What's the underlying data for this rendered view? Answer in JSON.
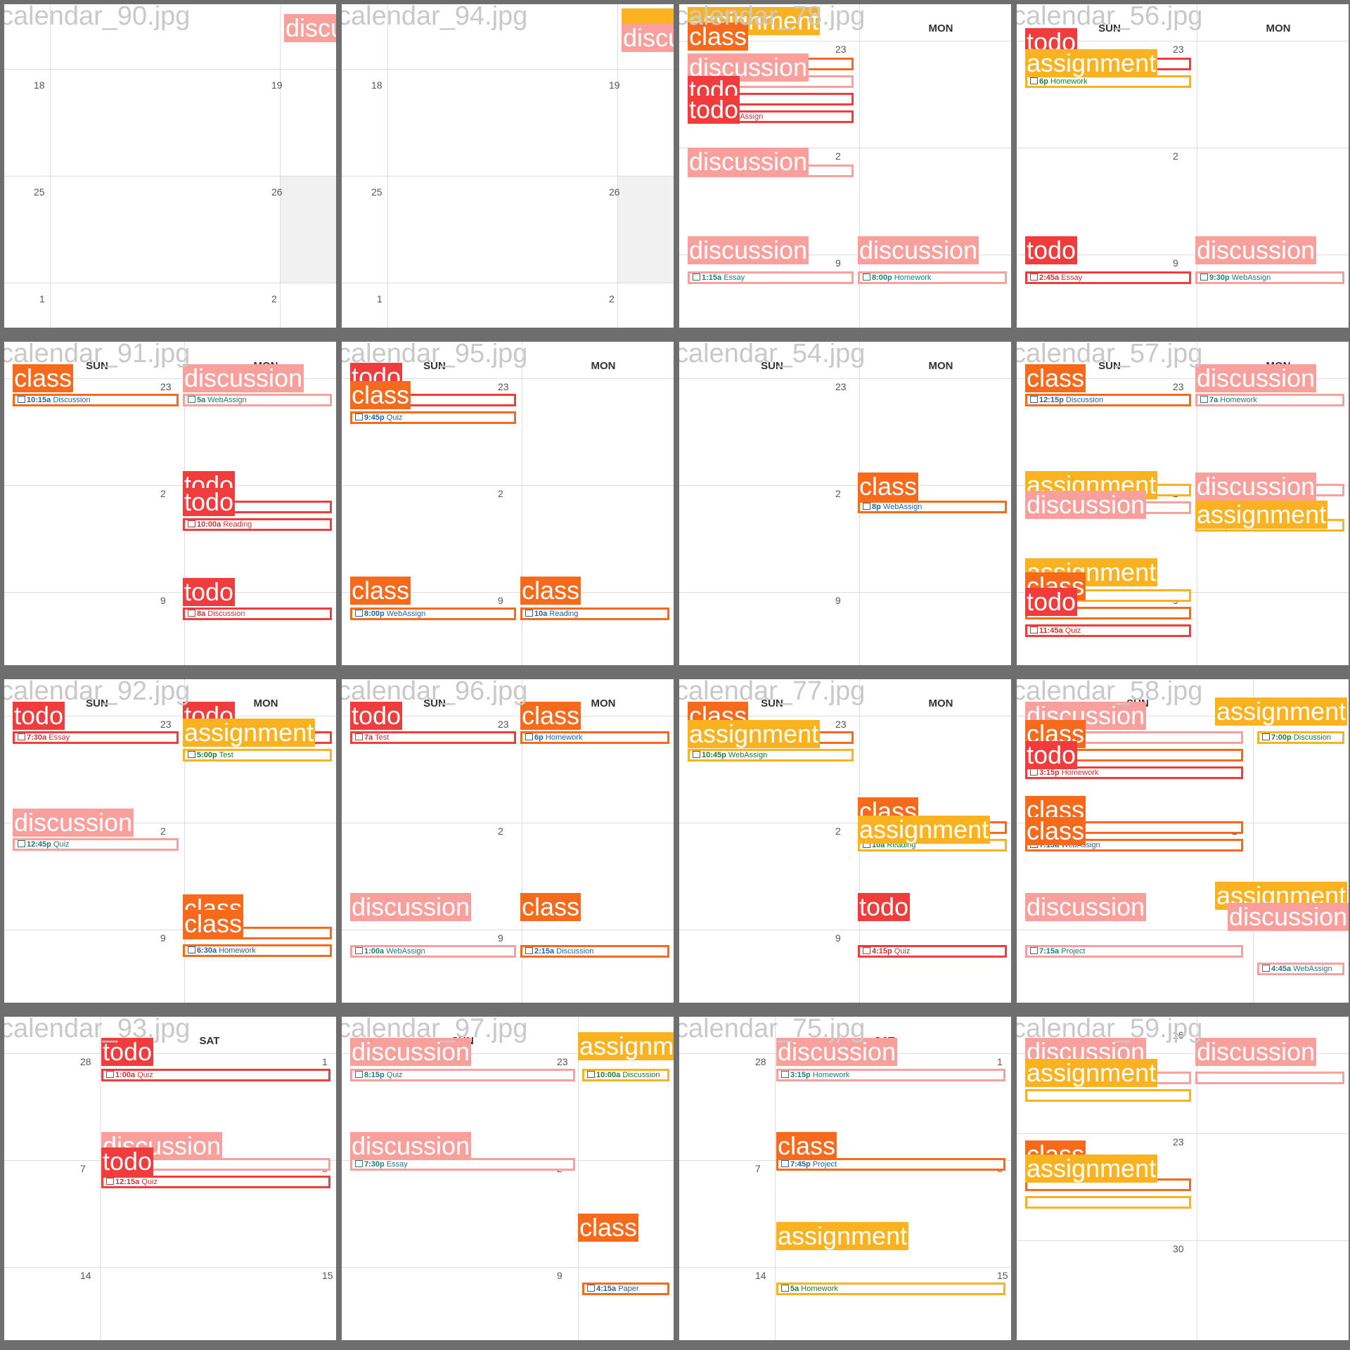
{
  "tiles": [
    {
      "file": "calendar_90.jpg",
      "headers": [],
      "nums": [
        "18",
        "19",
        "25",
        "26",
        "1",
        "2"
      ],
      "events": [],
      "labels": [
        {
          "cls": "discussion",
          "text": "discussion"
        }
      ]
    },
    {
      "file": "calendar_94.jpg",
      "headers": [],
      "nums": [
        "18",
        "19",
        "25",
        "26",
        "1",
        "2"
      ],
      "events": [],
      "labels": [
        {
          "cls": "assignment",
          "text": ""
        },
        {
          "cls": "discussion",
          "text": "discussion"
        }
      ]
    },
    {
      "file": "calendar_78.jpg",
      "headers": [
        "SUN",
        "MON"
      ],
      "nums": [
        "23",
        "2",
        "9"
      ],
      "events": [
        {
          "cls": "class",
          "time": "",
          "title": ""
        },
        {
          "cls": "discussion",
          "time": "",
          "title": "er"
        },
        {
          "cls": "todo",
          "time": "",
          "title": "bAssign"
        },
        {
          "cls": "todo",
          "time": "1:45p",
          "title": "WebAssign"
        },
        {
          "cls": "discussion",
          "time": "1:30a",
          "title": "Test"
        },
        {
          "cls": "discussion",
          "time": "1:15a",
          "title": "Essay"
        },
        {
          "cls": "discussion",
          "time": "8:00p",
          "title": "Homework"
        }
      ],
      "labels": [
        {
          "cls": "assignment",
          "text": "assignment"
        },
        {
          "cls": "class",
          "text": "class"
        },
        {
          "cls": "discussion",
          "text": "discussion"
        },
        {
          "cls": "todo",
          "text": "todo"
        },
        {
          "cls": "todo",
          "text": "todo"
        },
        {
          "cls": "discussion",
          "text": "discussion"
        },
        {
          "cls": "discussion",
          "text": "discussion"
        },
        {
          "cls": "discussion",
          "text": "discussion"
        }
      ]
    },
    {
      "file": "calendar_56.jpg",
      "headers": [
        "SUN",
        "MON"
      ],
      "nums": [
        "23",
        "2",
        "9"
      ],
      "events": [
        {
          "cls": "todo",
          "time": "",
          "title": ""
        },
        {
          "cls": "assignment",
          "time": "6p",
          "title": "Homework"
        },
        {
          "cls": "todo",
          "time": "2:45a",
          "title": "Essay"
        },
        {
          "cls": "discussion",
          "time": "9:30p",
          "title": "WebAssign"
        }
      ],
      "labels": [
        {
          "cls": "todo",
          "text": "todo"
        },
        {
          "cls": "assignment",
          "text": "assignment"
        },
        {
          "cls": "todo",
          "text": "todo"
        },
        {
          "cls": "discussion",
          "text": "discussion"
        }
      ]
    },
    {
      "file": "calendar_91.jpg",
      "headers": [
        "SUN",
        "MON"
      ],
      "nums": [
        "23",
        "2",
        "9"
      ],
      "events": [
        {
          "cls": "class",
          "time": "10:15a",
          "title": "Discussion"
        },
        {
          "cls": "discussion",
          "time": "5a",
          "title": "WebAssign"
        },
        {
          "cls": "todo",
          "time": "",
          "title": "nework"
        },
        {
          "cls": "todo",
          "time": "10:00a",
          "title": "Reading"
        },
        {
          "cls": "todo",
          "time": "8a",
          "title": "Discussion"
        }
      ],
      "labels": [
        {
          "cls": "class",
          "text": "class"
        },
        {
          "cls": "discussion",
          "text": "discussion"
        },
        {
          "cls": "todo",
          "text": "todo"
        },
        {
          "cls": "todo",
          "text": "todo"
        },
        {
          "cls": "todo",
          "text": "todo"
        }
      ]
    },
    {
      "file": "calendar_95.jpg",
      "headers": [
        "SUN",
        "MON"
      ],
      "nums": [
        "23",
        "2",
        "9"
      ],
      "events": [
        {
          "cls": "todo",
          "time": "",
          "title": "ssign"
        },
        {
          "cls": "class",
          "time": "9:45p",
          "title": "Quiz"
        },
        {
          "cls": "class",
          "time": "8:00p",
          "title": "WebAssign"
        },
        {
          "cls": "class",
          "time": "10a",
          "title": "Reading"
        }
      ],
      "labels": [
        {
          "cls": "todo",
          "text": "todo"
        },
        {
          "cls": "class",
          "text": "class"
        },
        {
          "cls": "class",
          "text": "class"
        },
        {
          "cls": "class",
          "text": "class"
        }
      ]
    },
    {
      "file": "calendar_54.jpg",
      "headers": [
        "SUN",
        "MON"
      ],
      "nums": [
        "23",
        "2",
        "9"
      ],
      "events": [
        {
          "cls": "class",
          "time": "8p",
          "title": "WebAssign"
        }
      ],
      "labels": [
        {
          "cls": "class",
          "text": "class"
        }
      ]
    },
    {
      "file": "calendar_57.jpg",
      "headers": [
        "SUN",
        "MON"
      ],
      "nums": [
        "23",
        "2",
        "9"
      ],
      "events": [
        {
          "cls": "class",
          "time": "12:15p",
          "title": "Discussion"
        },
        {
          "cls": "discussion",
          "time": "7a",
          "title": "Homework"
        },
        {
          "cls": "assignment",
          "time": "",
          "title": ""
        },
        {
          "cls": "discussion",
          "time": "5:15a",
          "title": "Essay"
        },
        {
          "cls": "discussion",
          "time": "",
          "title": ""
        },
        {
          "cls": "assignment",
          "time": "4:15p",
          "title": "Test"
        },
        {
          "cls": "assignment",
          "time": "",
          "title": ""
        },
        {
          "cls": "class",
          "time": "",
          "title": "mework"
        },
        {
          "cls": "todo",
          "time": "11:45a",
          "title": "Quiz"
        }
      ],
      "labels": [
        {
          "cls": "class",
          "text": "class"
        },
        {
          "cls": "discussion",
          "text": "discussion"
        },
        {
          "cls": "assignment",
          "text": "assignment"
        },
        {
          "cls": "discussion",
          "text": "discussion"
        },
        {
          "cls": "discussion",
          "text": "discussion"
        },
        {
          "cls": "assignment",
          "text": "assignment"
        },
        {
          "cls": "assignment",
          "text": "assignment"
        },
        {
          "cls": "class",
          "text": "class"
        },
        {
          "cls": "todo",
          "text": "todo"
        }
      ]
    },
    {
      "file": "calendar_92.jpg",
      "headers": [
        "SUN",
        "MON"
      ],
      "nums": [
        "23",
        "2",
        "9"
      ],
      "events": [
        {
          "cls": "todo",
          "time": "7:30a",
          "title": "Essay"
        },
        {
          "cls": "todo",
          "time": "",
          "title": ""
        },
        {
          "cls": "assignment",
          "time": "5:00p",
          "title": "Test"
        },
        {
          "cls": "discussion",
          "time": "12:45p",
          "title": "Quiz"
        },
        {
          "cls": "class",
          "time": "",
          "title": ""
        },
        {
          "cls": "class",
          "time": "6:30a",
          "title": "Homework"
        }
      ],
      "labels": [
        {
          "cls": "todo",
          "text": "todo"
        },
        {
          "cls": "todo",
          "text": "todo"
        },
        {
          "cls": "assignment",
          "text": "assignment"
        },
        {
          "cls": "discussion",
          "text": "discussion"
        },
        {
          "cls": "class",
          "text": "class"
        },
        {
          "cls": "class",
          "text": "class"
        }
      ]
    },
    {
      "file": "calendar_96.jpg",
      "headers": [
        "SUN",
        "MON"
      ],
      "nums": [
        "23",
        "2",
        "9"
      ],
      "events": [
        {
          "cls": "todo",
          "time": "7a",
          "title": "Test"
        },
        {
          "cls": "class",
          "time": "6p",
          "title": "Homework"
        },
        {
          "cls": "discussion",
          "time": "1:00a",
          "title": "WebAssign"
        },
        {
          "cls": "class",
          "time": "2:15a",
          "title": "Discussion"
        }
      ],
      "labels": [
        {
          "cls": "todo",
          "text": "todo"
        },
        {
          "cls": "class",
          "text": "class"
        },
        {
          "cls": "discussion",
          "text": "discussion"
        },
        {
          "cls": "class",
          "text": "class"
        }
      ]
    },
    {
      "file": "calendar_77.jpg",
      "headers": [
        "SUN",
        "MON"
      ],
      "nums": [
        "23",
        "2",
        "9"
      ],
      "events": [
        {
          "cls": "class",
          "time": "",
          "title": ""
        },
        {
          "cls": "assignment",
          "time": "10:45p",
          "title": "WebAssign"
        },
        {
          "cls": "class",
          "time": "",
          "title": ""
        },
        {
          "cls": "assignment",
          "time": "10a",
          "title": "Reading"
        },
        {
          "cls": "todo",
          "time": "4:15p",
          "title": "Quiz"
        }
      ],
      "labels": [
        {
          "cls": "class",
          "text": "class"
        },
        {
          "cls": "assignment",
          "text": "assignment"
        },
        {
          "cls": "class",
          "text": "class"
        },
        {
          "cls": "assignment",
          "text": "assignment"
        },
        {
          "cls": "todo",
          "text": "todo"
        }
      ]
    },
    {
      "file": "calendar_58.jpg",
      "headers": [
        "SUN",
        ""
      ],
      "nums": [
        "2"
      ],
      "events": [
        {
          "cls": "discussion",
          "time": "",
          "title": ""
        },
        {
          "cls": "assignment",
          "time": "7:00p",
          "title": "Discussion"
        },
        {
          "cls": "class",
          "time": "",
          "title": "ding"
        },
        {
          "cls": "todo",
          "time": "3:15p",
          "title": "Homework"
        },
        {
          "cls": "class",
          "time": "",
          "title": "t"
        },
        {
          "cls": "class",
          "time": "7:15a",
          "title": "WebAssign"
        },
        {
          "cls": "discussion",
          "time": "7:15a",
          "title": "Project"
        },
        {
          "cls": "discussion",
          "time": "4:45a",
          "title": "WebAssign"
        }
      ],
      "labels": [
        {
          "cls": "discussion",
          "text": "discussion"
        },
        {
          "cls": "assignment",
          "text": "assignment"
        },
        {
          "cls": "class",
          "text": "class"
        },
        {
          "cls": "todo",
          "text": "todo"
        },
        {
          "cls": "class",
          "text": "class"
        },
        {
          "cls": "class",
          "text": "class"
        },
        {
          "cls": "discussion",
          "text": "discussion"
        },
        {
          "cls": "assignment",
          "text": "assignment"
        },
        {
          "cls": "discussion",
          "text": "discussion"
        }
      ]
    },
    {
      "file": "calendar_93.jpg",
      "headers": [
        "SAT"
      ],
      "nums": [
        "28",
        "1",
        "7",
        "8",
        "14",
        "15"
      ],
      "events": [
        {
          "cls": "todo",
          "time": "1:00a",
          "title": "Quiz"
        },
        {
          "cls": "discussion",
          "time": "",
          "title": ""
        },
        {
          "cls": "todo",
          "time": "12:15a",
          "title": "Quiz"
        }
      ],
      "labels": [
        {
          "cls": "todo",
          "text": "todo"
        },
        {
          "cls": "discussion",
          "text": "discussion"
        },
        {
          "cls": "todo",
          "text": "todo"
        }
      ]
    },
    {
      "file": "calendar_97.jpg",
      "headers": [
        "SUN"
      ],
      "nums": [
        "23",
        "2",
        "9"
      ],
      "events": [
        {
          "cls": "discussion",
          "time": "8:15p",
          "title": "Quiz"
        },
        {
          "cls": "assignment",
          "time": "10:00a",
          "title": "Discussion"
        },
        {
          "cls": "discussion",
          "time": "7:30p",
          "title": "Essay"
        },
        {
          "cls": "class",
          "time": "4:15a",
          "title": "Paper"
        }
      ],
      "labels": [
        {
          "cls": "discussion",
          "text": "discussion"
        },
        {
          "cls": "assignment",
          "text": "assignment"
        },
        {
          "cls": "discussion",
          "text": "discussion"
        },
        {
          "cls": "class",
          "text": "class"
        }
      ]
    },
    {
      "file": "calendar_75.jpg",
      "headers": [
        "SAT"
      ],
      "nums": [
        "28",
        "1",
        "7",
        "8",
        "14",
        "15"
      ],
      "events": [
        {
          "cls": "discussion",
          "time": "3:15p",
          "title": "Homework"
        },
        {
          "cls": "class",
          "time": "7:45p",
          "title": "Project"
        },
        {
          "cls": "assignment",
          "time": "5a",
          "title": "Homework"
        }
      ],
      "labels": [
        {
          "cls": "discussion",
          "text": "discussion"
        },
        {
          "cls": "class",
          "text": "class"
        },
        {
          "cls": "assignment",
          "text": "assignment"
        }
      ]
    },
    {
      "file": "calendar_59.jpg",
      "headers": [],
      "nums": [
        "16",
        "23",
        "30"
      ],
      "events": [
        {
          "cls": "discussion",
          "time": "",
          "title": ""
        },
        {
          "cls": "assignment",
          "time": "",
          "title": ""
        },
        {
          "cls": "discussion",
          "time": "",
          "title": ""
        },
        {
          "cls": "class",
          "time": "",
          "title": ""
        },
        {
          "cls": "assignment",
          "time": "",
          "title": ""
        }
      ],
      "labels": [
        {
          "cls": "discussion",
          "text": "discussion"
        },
        {
          "cls": "assignment",
          "text": "assignment"
        },
        {
          "cls": "discussion",
          "text": "discussion"
        },
        {
          "cls": "class",
          "text": "class"
        },
        {
          "cls": "assignment",
          "text": "assignment"
        }
      ]
    }
  ]
}
